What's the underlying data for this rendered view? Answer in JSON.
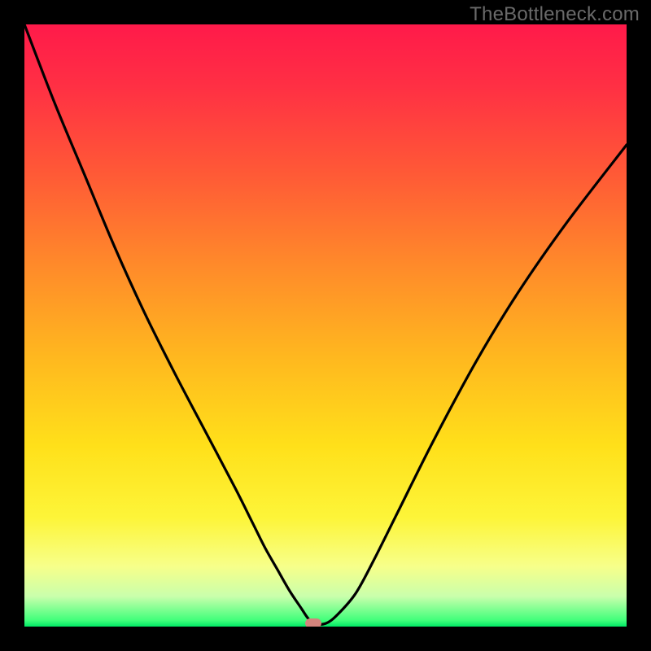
{
  "watermark": "TheBottleneck.com",
  "colors": {
    "frame_border": "#000000",
    "curve": "#000000",
    "marker": "#d4847d",
    "gradient_top": "#ff1a4a",
    "gradient_bottom": "#00e865"
  },
  "chart_data": {
    "type": "line",
    "title": "",
    "xlabel": "",
    "ylabel": "",
    "xlim": [
      0,
      100
    ],
    "ylim": [
      0,
      100
    ],
    "grid": false,
    "legend": false,
    "series": [
      {
        "name": "bottleneck-curve",
        "x": [
          0,
          5,
          10,
          15,
          20,
          25,
          30,
          35,
          38,
          40,
          42,
          44,
          46,
          47,
          48,
          50,
          52,
          55,
          58,
          62,
          68,
          75,
          82,
          90,
          100
        ],
        "y": [
          100,
          87,
          75,
          63,
          52,
          42,
          32.5,
          23,
          17,
          13,
          9.5,
          6,
          3,
          1.5,
          0.5,
          0.5,
          2,
          5.5,
          11,
          19,
          31,
          44,
          55.5,
          67,
          80
        ]
      }
    ],
    "marker": {
      "name": "optimal-point",
      "x": 48,
      "y": 0.5
    }
  }
}
